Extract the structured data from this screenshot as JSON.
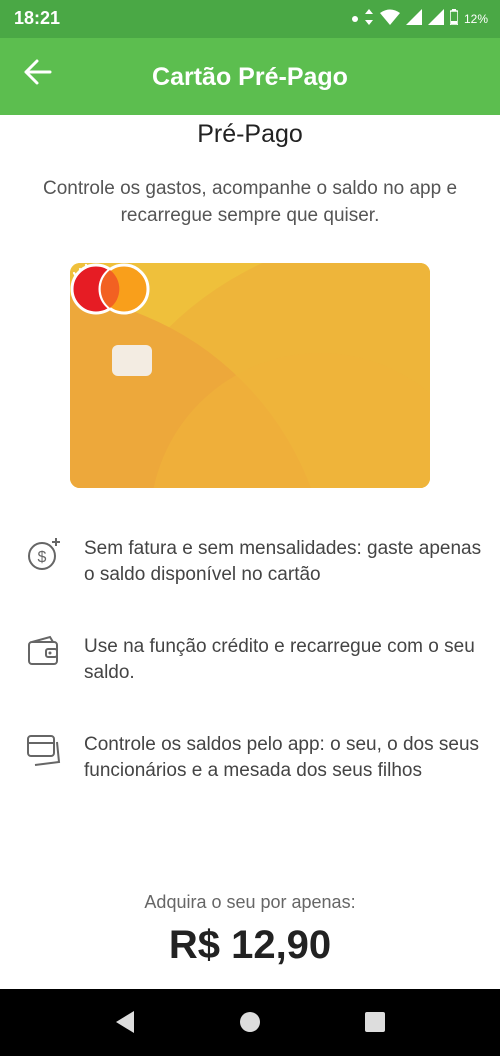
{
  "status_bar": {
    "time": "18:21",
    "battery": "12%"
  },
  "header": {
    "title": "Cartão Pré-Pago"
  },
  "main": {
    "heading": "Pré-Pago",
    "subtitle": "Controle os gastos, acompanhe o saldo no app e recarregue sempre que quiser.",
    "features": [
      {
        "icon": "dollar-plus-icon",
        "text": "Sem fatura e sem mensalidades: gaste apenas o saldo disponível no cartão"
      },
      {
        "icon": "wallet-icon",
        "text": "Use na função crédito e recarregue com o seu saldo."
      },
      {
        "icon": "cards-icon",
        "text": "Controle os saldos pelo app: o seu, o dos seus funcionários e a mesada dos seus filhos"
      }
    ],
    "price_label": "Adquira o seu por apenas:",
    "price": "R$ 12,90"
  },
  "colors": {
    "status_bar": "#4aa845",
    "app_bar": "#5cbe4f",
    "card": "#efc03b",
    "mastercard_red": "#e61c24",
    "mastercard_orange": "#f99f1b"
  }
}
